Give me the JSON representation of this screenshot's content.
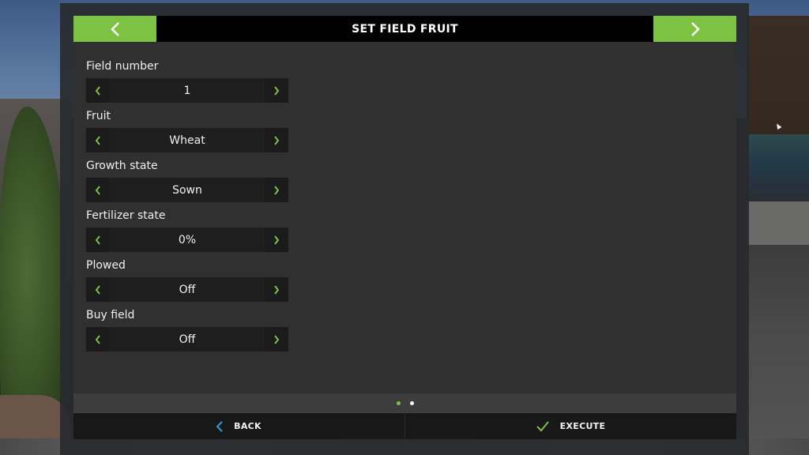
{
  "header": {
    "title": "SET FIELD FRUIT",
    "prev_icon": "chevron-left-icon",
    "next_icon": "chevron-right-icon"
  },
  "settings": [
    {
      "label": "Field number",
      "value": "1"
    },
    {
      "label": "Fruit",
      "value": "Wheat"
    },
    {
      "label": "Growth state",
      "value": "Sown"
    },
    {
      "label": "Fertilizer state",
      "value": "0%"
    },
    {
      "label": "Plowed",
      "value": "Off"
    },
    {
      "label": "Buy field",
      "value": "Off"
    }
  ],
  "pager": {
    "total_pages": 2,
    "current_page": 1
  },
  "footer": {
    "back_label": "BACK",
    "back_icon": "chevron-left-icon",
    "execute_label": "EXECUTE",
    "execute_icon": "checkmark-icon"
  },
  "colors": {
    "accent": "#7dc242",
    "back_icon": "#3a9ad9",
    "header_bg": "#000000",
    "panel_bg": "#303030"
  }
}
